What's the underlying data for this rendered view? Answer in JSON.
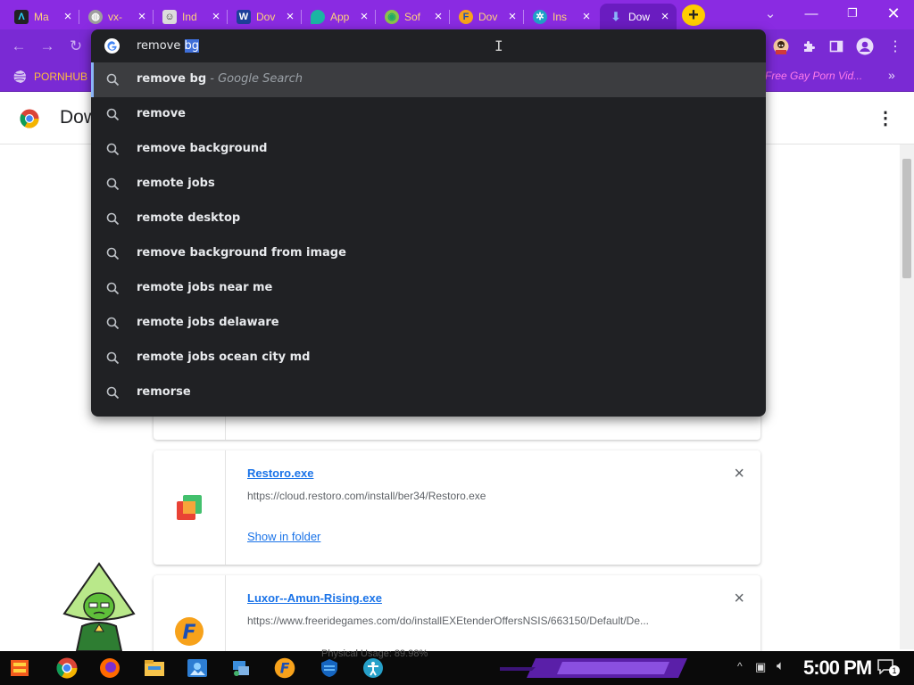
{
  "tabs": [
    {
      "title": "Ma",
      "icon": "a-logo-icon",
      "active": false
    },
    {
      "title": "vx-",
      "icon": "globe-icon",
      "active": false
    },
    {
      "title": "Ind",
      "icon": "robot-icon",
      "active": false
    },
    {
      "title": "Dov",
      "icon": "w-logo-icon",
      "active": false
    },
    {
      "title": "App",
      "icon": "drop-icon",
      "active": false
    },
    {
      "title": "Sof",
      "icon": "planet-icon",
      "active": false
    },
    {
      "title": "Dov",
      "icon": "f-logo-icon",
      "active": false
    },
    {
      "title": "Ins",
      "icon": "wheel-icon",
      "active": false
    },
    {
      "title": "Dow",
      "icon": "download-icon",
      "active": true
    }
  ],
  "toolbar": {
    "new_tab_glyph": "+"
  },
  "bookmarks": {
    "left_label": "PORNHUB",
    "right_label": "Free Gay Porn Vid...",
    "overflow": "»"
  },
  "omnibox": {
    "typed": "remove ",
    "selected_completion": "bg",
    "suggestions": [
      {
        "text": "remove bg",
        "suffix": " - Google Search",
        "selected": true
      },
      {
        "text": "remove",
        "suffix": ""
      },
      {
        "text": "remove background",
        "suffix": ""
      },
      {
        "text": "remote jobs",
        "suffix": ""
      },
      {
        "text": "remote desktop",
        "suffix": ""
      },
      {
        "text": "remove background from image",
        "suffix": ""
      },
      {
        "text": "remote jobs near me",
        "suffix": ""
      },
      {
        "text": "remote jobs delaware",
        "suffix": ""
      },
      {
        "text": "remote jobs ocean city md",
        "suffix": ""
      },
      {
        "text": "remorse",
        "suffix": ""
      }
    ]
  },
  "page": {
    "title": "Dow"
  },
  "downloads": [
    {
      "file": "Restoro.exe",
      "url": "https://cloud.restoro.com/install/ber34/Restoro.exe",
      "action": "Show in folder",
      "icon": "restoro-icon"
    },
    {
      "file": "Luxor--Amun-Rising.exe",
      "url": "https://www.freeridegames.com/do/installEXEtenderOffersNSIS/663150/Default/De...",
      "action": "",
      "icon": "freeride-icon"
    }
  ],
  "taskbar": {
    "clock": "5:00 PM",
    "overlay": "Physical Usage: 89.98%",
    "notification_count": "1"
  },
  "colors": {
    "chrome_purple": "#8a2be2",
    "dropdown_bg": "#202124",
    "link_blue": "#1a73e8"
  }
}
